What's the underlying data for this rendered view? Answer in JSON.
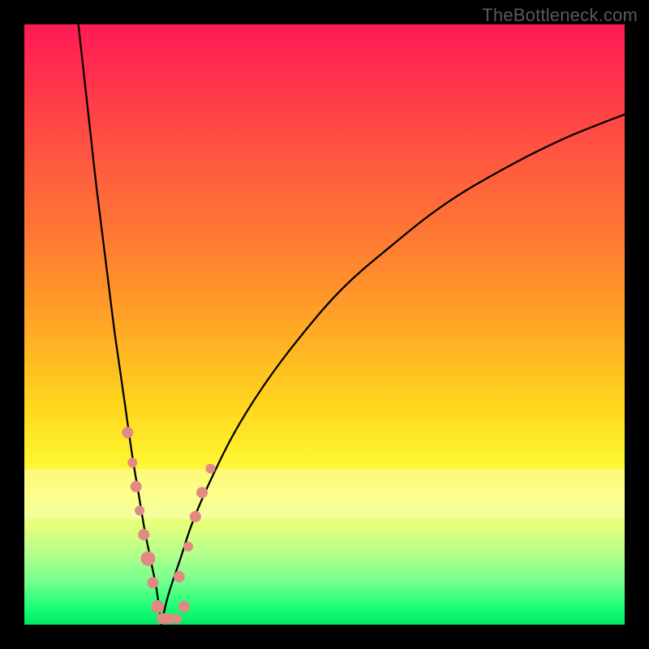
{
  "watermark": {
    "text": "TheBottleneck.com"
  },
  "chart_data": {
    "type": "line",
    "title": "",
    "xlabel": "",
    "ylabel": "",
    "xlim": [
      0,
      100
    ],
    "ylim": [
      0,
      100
    ],
    "grid": false,
    "legend": false,
    "series": [
      {
        "name": "left-branch",
        "x": [
          9,
          10,
          11,
          12,
          13,
          14,
          15,
          16,
          17,
          18,
          19,
          20,
          21,
          22,
          22.8
        ],
        "y": [
          100,
          91,
          82,
          73,
          65,
          57,
          49,
          42,
          35,
          28,
          22,
          16,
          11,
          6,
          0
        ]
      },
      {
        "name": "right-branch",
        "x": [
          22.8,
          24,
          26,
          28,
          31,
          35,
          40,
          46,
          53,
          61,
          70,
          80,
          90,
          100
        ],
        "y": [
          0,
          5,
          11,
          17,
          24,
          32,
          40,
          48,
          56,
          63,
          70,
          76,
          81,
          85
        ]
      }
    ],
    "annotations": [
      {
        "name": "dot",
        "x": 17.2,
        "y": 32,
        "r": 7,
        "color": "#e18a84"
      },
      {
        "name": "dot",
        "x": 18.0,
        "y": 27,
        "r": 6,
        "color": "#e18a84"
      },
      {
        "name": "dot",
        "x": 18.6,
        "y": 23,
        "r": 7,
        "color": "#e18a84"
      },
      {
        "name": "dot",
        "x": 19.2,
        "y": 19,
        "r": 6,
        "color": "#e18a84"
      },
      {
        "name": "dot",
        "x": 19.9,
        "y": 15,
        "r": 7,
        "color": "#e18a84"
      },
      {
        "name": "dot",
        "x": 20.6,
        "y": 11,
        "r": 9,
        "color": "#e18a84"
      },
      {
        "name": "dot",
        "x": 21.4,
        "y": 7,
        "r": 7,
        "color": "#e18a84"
      },
      {
        "name": "dot",
        "x": 22.2,
        "y": 3,
        "r": 8,
        "color": "#e18a84"
      },
      {
        "name": "dot",
        "x": 23.0,
        "y": 1,
        "r": 7,
        "color": "#e18a84"
      },
      {
        "name": "dot",
        "x": 24.0,
        "y": 1,
        "r": 7,
        "color": "#e18a84"
      },
      {
        "name": "dot",
        "x": 25.4,
        "y": 1,
        "r": 6,
        "color": "#e18a84"
      },
      {
        "name": "dot",
        "x": 26.6,
        "y": 3,
        "r": 7,
        "color": "#e18a84"
      },
      {
        "name": "dot",
        "x": 25.8,
        "y": 8,
        "r": 7,
        "color": "#e18a84"
      },
      {
        "name": "dot",
        "x": 27.3,
        "y": 13,
        "r": 6,
        "color": "#e18a84"
      },
      {
        "name": "dot",
        "x": 28.5,
        "y": 18,
        "r": 7,
        "color": "#e18a84"
      },
      {
        "name": "dot",
        "x": 29.6,
        "y": 22,
        "r": 7,
        "color": "#e18a84"
      },
      {
        "name": "dot",
        "x": 31.0,
        "y": 26,
        "r": 6,
        "color": "#e18a84"
      }
    ],
    "background": {
      "type": "vertical-gradient",
      "stops": [
        {
          "pos": 0.0,
          "color": "#ff1a56"
        },
        {
          "pos": 0.5,
          "color": "#ffad24"
        },
        {
          "pos": 0.78,
          "color": "#fbff55"
        },
        {
          "pos": 1.0,
          "color": "#00e864"
        }
      ]
    }
  }
}
